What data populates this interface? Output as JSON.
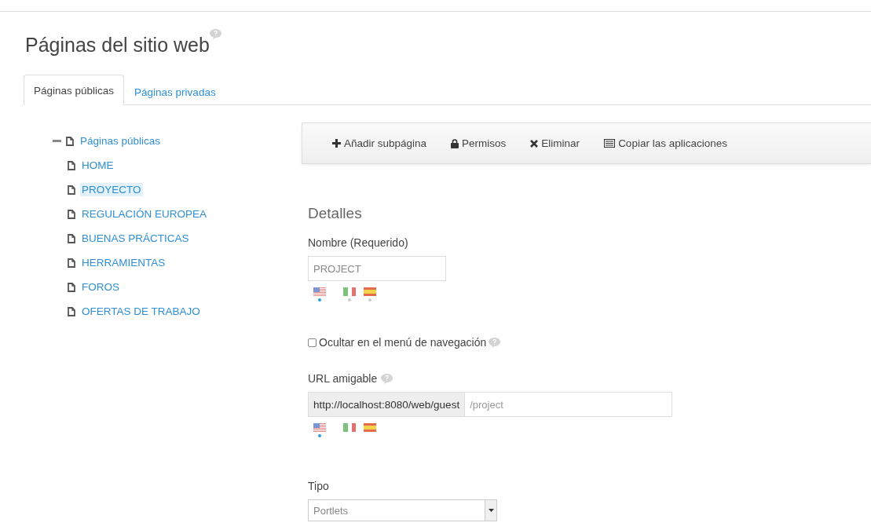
{
  "title": "Páginas del sitio web",
  "tabs": [
    {
      "label": "Páginas públicas",
      "selected": true
    },
    {
      "label": "Páginas privadas",
      "selected": false
    }
  ],
  "tree": {
    "label": "Páginas públicas",
    "expanded": true,
    "children": [
      {
        "label": "HOME",
        "selected": false
      },
      {
        "label": "PROYECTO",
        "selected": true
      },
      {
        "label": "REGULACIÓN EUROPEA",
        "selected": false
      },
      {
        "label": "BUENAS PRÁCTICAS",
        "selected": false
      },
      {
        "label": "HERRAMIENTAS",
        "selected": false
      },
      {
        "label": "FOROS",
        "selected": false
      },
      {
        "label": "OFERTAS DE TRABAJO",
        "selected": false
      }
    ]
  },
  "toolbar": [
    {
      "kind": "plus",
      "label": "Añadir subpágina"
    },
    {
      "kind": "lock",
      "label": "Permisos"
    },
    {
      "kind": "cross",
      "label": "Eliminar"
    },
    {
      "kind": "list",
      "label": "Copiar las aplicaciones"
    }
  ],
  "details": {
    "heading": "Detalles",
    "name_field": {
      "label": "Nombre (Requerido)",
      "value": "PROJECT",
      "flags": [
        {
          "kind": "us",
          "selected": true
        },
        {
          "kind": "it",
          "selected": false,
          "translated": true
        },
        {
          "kind": "es",
          "selected": false,
          "translated": true
        }
      ]
    },
    "hide_checkbox": {
      "label": "Ocultar en el menú de navegación",
      "checked": false
    },
    "friendly_url": {
      "label": "URL amigable",
      "prefix": "http://localhost:8080/web/guest",
      "value": "/project",
      "flags": [
        {
          "kind": "us",
          "selected": true
        },
        {
          "kind": "it",
          "selected": false,
          "translated": false
        },
        {
          "kind": "es",
          "selected": false,
          "translated": false
        }
      ]
    },
    "type": {
      "label": "Tipo",
      "value": "Portlets"
    }
  }
}
